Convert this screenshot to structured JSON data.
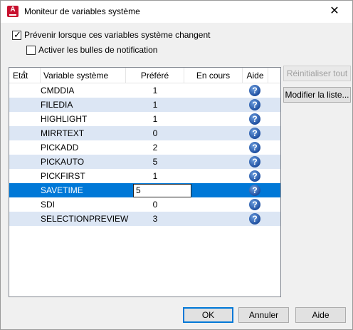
{
  "window": {
    "title": "Moniteur de variables système",
    "close_glyph": "✕",
    "app_icon": "autocad-icon",
    "app_icon_glyph": "A"
  },
  "options": {
    "notify_label": "Prévenir lorsque ces variables système changent",
    "notify_checked": true,
    "bubbles_label": "Activer les bulles de notification",
    "bubbles_checked": false
  },
  "table": {
    "columns": [
      "Etat",
      "Variable système",
      "Préféré",
      "En cours",
      "Aide"
    ],
    "rows": [
      {
        "variable": "CMDDIA",
        "preferred": "1",
        "current": "",
        "help": "?"
      },
      {
        "variable": "FILEDIA",
        "preferred": "1",
        "current": "",
        "help": "?"
      },
      {
        "variable": "HIGHLIGHT",
        "preferred": "1",
        "current": "",
        "help": "?"
      },
      {
        "variable": "MIRRTEXT",
        "preferred": "0",
        "current": "",
        "help": "?"
      },
      {
        "variable": "PICKADD",
        "preferred": "2",
        "current": "",
        "help": "?"
      },
      {
        "variable": "PICKAUTO",
        "preferred": "5",
        "current": "",
        "help": "?"
      },
      {
        "variable": "PICKFIRST",
        "preferred": "1",
        "current": "",
        "help": "?"
      },
      {
        "variable": "SAVETIME",
        "preferred": "5",
        "current": "",
        "help": "?"
      },
      {
        "variable": "SDI",
        "preferred": "0",
        "current": "",
        "help": "?"
      },
      {
        "variable": "SELECTIONPREVIEW",
        "preferred": "3",
        "current": "",
        "help": "?"
      }
    ],
    "selected_row": 7
  },
  "side_buttons": {
    "reset_all": "Réinitialiser tout",
    "edit_list": "Modifier la liste..."
  },
  "footer": {
    "ok": "OK",
    "cancel": "Annuler",
    "help": "Aide"
  },
  "colors": {
    "selection": "#0078d7",
    "alt_row": "#dce6f4",
    "brand_red": "#c8102e"
  }
}
